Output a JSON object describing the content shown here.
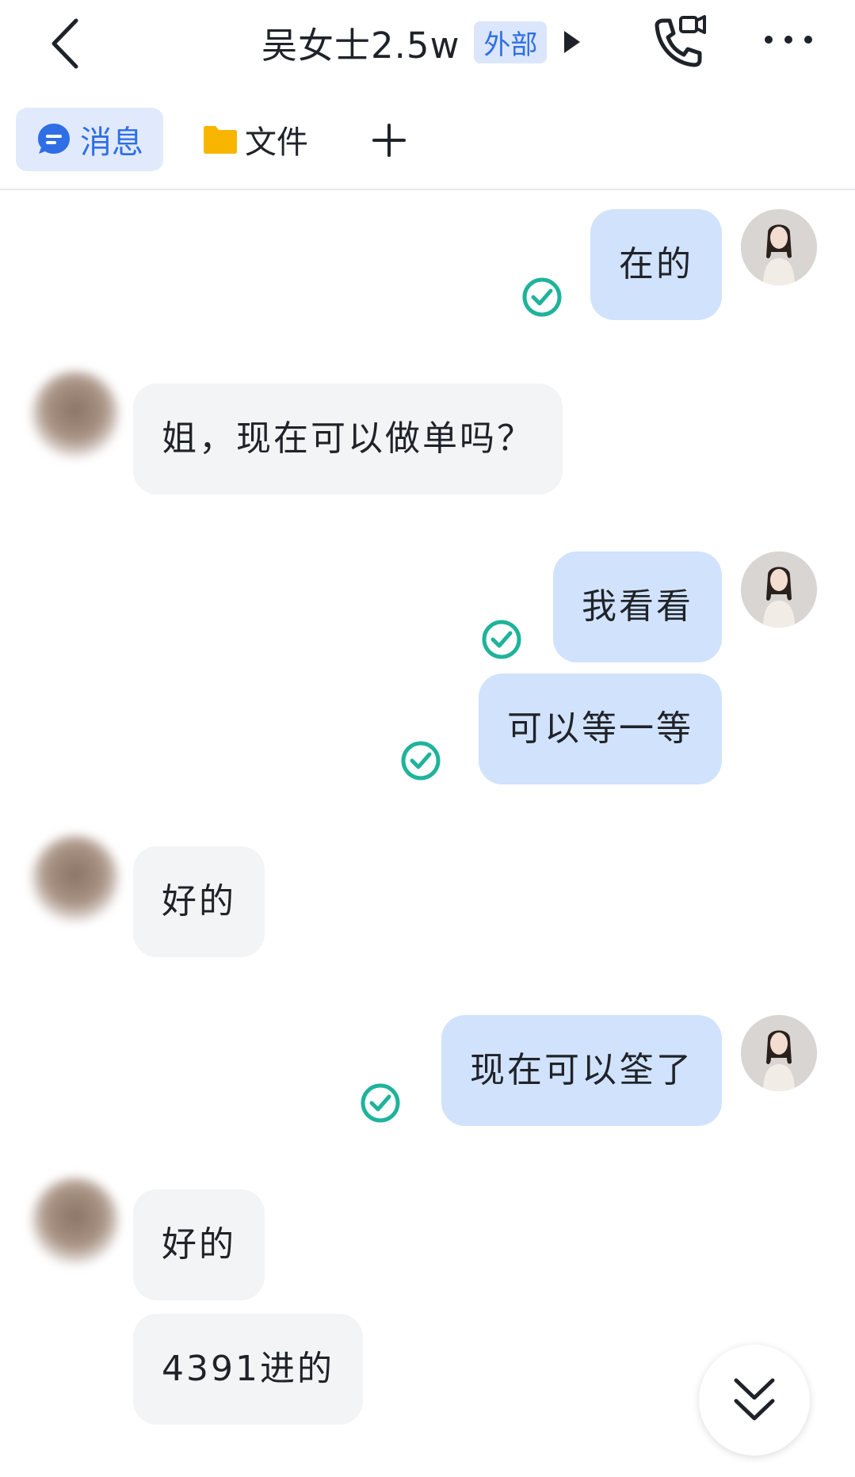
{
  "header": {
    "title": "吴女士2.5w",
    "badge": "外部",
    "icons": [
      "back-icon",
      "play-triangle-icon",
      "phone-video-icon",
      "more-icon"
    ]
  },
  "tabs": [
    {
      "label": "消息",
      "icon": "chat-bubble-icon",
      "active": true
    },
    {
      "label": "文件",
      "icon": "folder-icon",
      "active": false
    }
  ],
  "messages": [
    {
      "side": "out",
      "text": "在的",
      "status": "read"
    },
    {
      "side": "in",
      "text": "姐，现在可以做单吗？"
    },
    {
      "side": "out",
      "text": "我看看",
      "status": "read"
    },
    {
      "side": "out",
      "text": "可以等一等",
      "status": "read"
    },
    {
      "side": "in",
      "text": "好的"
    },
    {
      "side": "out",
      "text": "现在可以筌了",
      "status": "read"
    },
    {
      "side": "in",
      "text": "好的"
    },
    {
      "side": "in",
      "text": "4391进的"
    }
  ],
  "colors": {
    "accent": "#2f6fe6",
    "outgoing_bubble": "#d1e2fc",
    "incoming_bubble": "#f3f4f5",
    "read_check": "#1fb39b",
    "folder": "#f7b500"
  }
}
